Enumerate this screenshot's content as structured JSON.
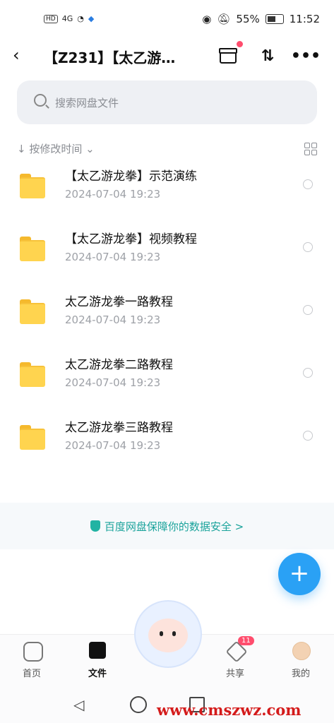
{
  "status": {
    "time": "11:52",
    "battery": "55%",
    "left_icons": [
      "HD",
      "4G"
    ]
  },
  "header": {
    "title": "【Z231】【太乙游…"
  },
  "search": {
    "placeholder": "搜索网盘文件"
  },
  "sort": {
    "label": "↓ 按修改时间 ⌄"
  },
  "files": [
    {
      "name": "【太乙游龙拳】示范演练",
      "date": "2024-07-04  19:23"
    },
    {
      "name": "【太乙游龙拳】视频教程",
      "date": "2024-07-04  19:23"
    },
    {
      "name": "太乙游龙拳一路教程",
      "date": "2024-07-04  19:23"
    },
    {
      "name": "太乙游龙拳二路教程",
      "date": "2024-07-04  19:23"
    },
    {
      "name": "太乙游龙拳三路教程",
      "date": "2024-07-04  19:23"
    }
  ],
  "banner": {
    "text": "百度网盘保障你的数据安全 >"
  },
  "tabs": [
    {
      "label": "首页"
    },
    {
      "label": "文件"
    },
    {
      "label": "共享",
      "badge": "11"
    },
    {
      "label": "我的"
    }
  ],
  "watermark": "www.cmszwz.com",
  "colors": {
    "accent": "#2aa1f5",
    "folder": "#ffd44f",
    "banner_text": "#1aa39b",
    "badge": "#ff4d6d"
  },
  "icons": [
    "back-icon",
    "archive-icon",
    "sort-arrows-icon",
    "more-icon",
    "search-icon",
    "grid-view-icon",
    "folder-icon",
    "radio-icon",
    "shield-icon",
    "plus-icon",
    "home-icon",
    "file-icon",
    "share-icon",
    "avatar-icon"
  ]
}
